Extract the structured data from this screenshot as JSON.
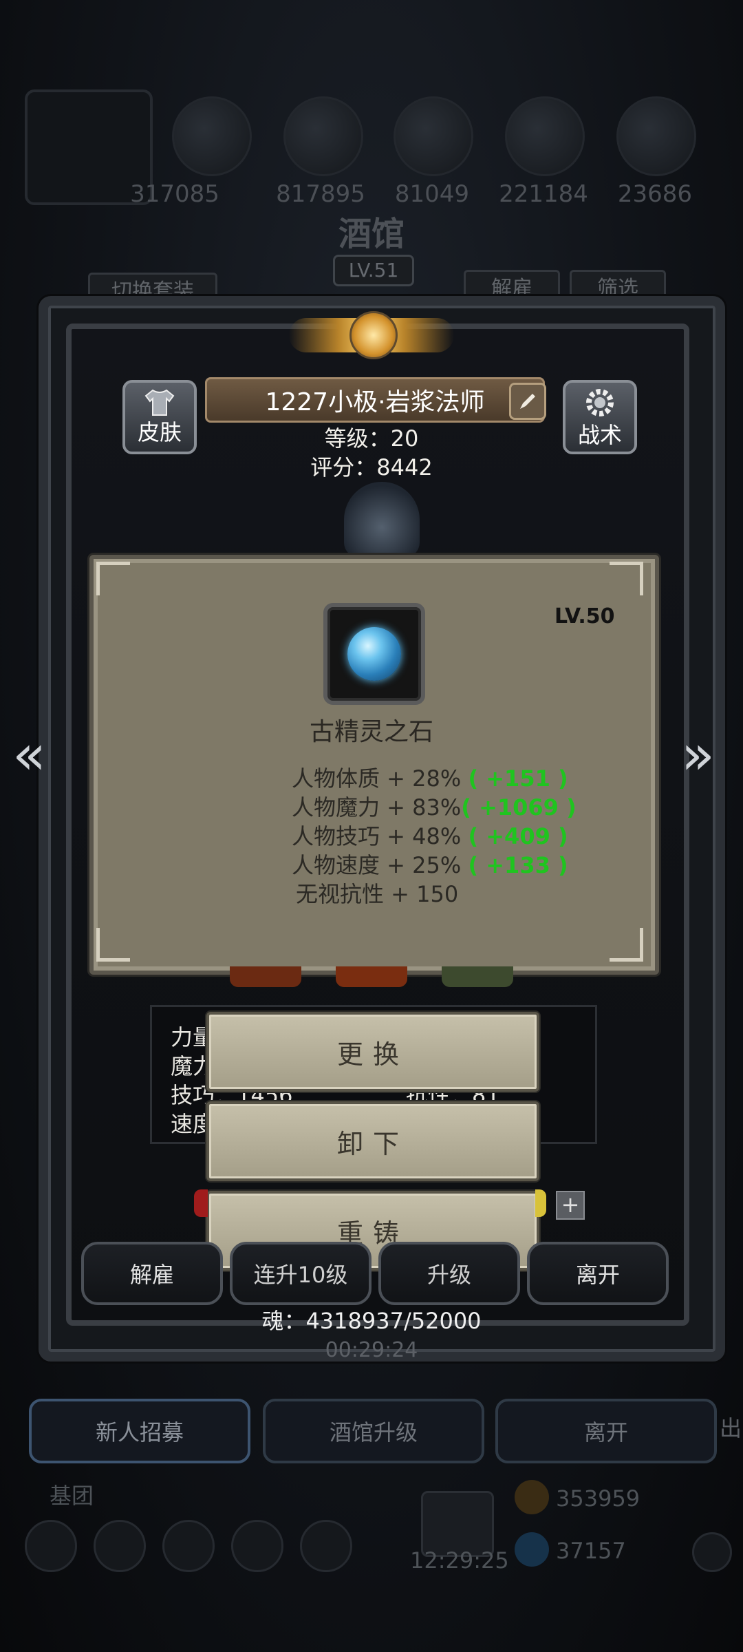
{
  "header": {
    "tavern_title": "酒馆",
    "tavern_level": "LV.51",
    "resources": [
      "317085",
      "817895",
      "81049",
      "221184",
      "23686"
    ],
    "switch_outfit": "切换套装",
    "dismiss": "解雇",
    "filter": "筛选"
  },
  "hero": {
    "skin_label": "皮肤",
    "tactics_label": "战术",
    "name": "1227小极·岩浆法师",
    "level_line": "等级：20",
    "score_line": "评分：8442"
  },
  "item_popup": {
    "level": "LV.50",
    "name": "古精灵之石",
    "attributes": [
      {
        "text": "人物体质 + 28% ",
        "bonus": "( +151 )"
      },
      {
        "text": "人物魔力 + 83%",
        "bonus": "( +1069 )"
      },
      {
        "text": "人物技巧 + 48% ",
        "bonus": "( +409 )"
      },
      {
        "text": "人物速度 + 25% ",
        "bonus": "( +133 )"
      },
      {
        "text": "无视抗性 + 150",
        "bonus": ""
      }
    ]
  },
  "stats_partial": {
    "row1": "力量",
    "row2": "魔力",
    "row3": "技巧：1456",
    "row3b": "抗性：81",
    "row4": "速度"
  },
  "action_menu": {
    "replace": "更换",
    "unequip": "卸下",
    "reforge": "重铸"
  },
  "bottom_actions": {
    "dismiss": "解雇",
    "level10": "连升10级",
    "upgrade": "升级",
    "leave": "离开"
  },
  "soul_line": "魂：4318937/52000",
  "timer": "00:29:24",
  "lower_nav": {
    "recruit": "新人招募",
    "tavern_upgrade": "酒馆升级",
    "leave": "离开",
    "side": "出"
  },
  "footer": {
    "group": "基团",
    "clock": "12:29:25",
    "gold": "353959",
    "gems": "37157"
  },
  "colors": {
    "bonus_green": "#1fc41f",
    "popup_bg": "#7f7967",
    "menu_bg": "#bfb9a3"
  }
}
